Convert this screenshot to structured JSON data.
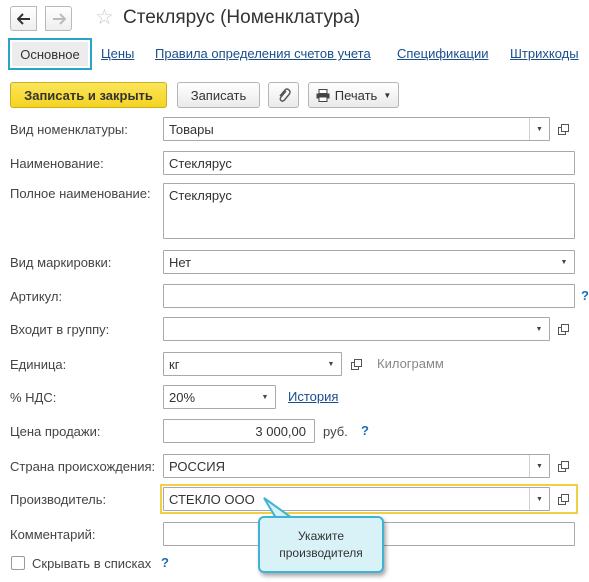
{
  "window": {
    "title": "Стеклярус (Номенклатура)",
    "star_icon": "star-icon"
  },
  "tabs": [
    {
      "label": "Основное",
      "active": true
    },
    {
      "label": "Цены"
    },
    {
      "label": "Правила определения счетов учета"
    },
    {
      "label": "Спецификации"
    },
    {
      "label": "Штрихкоды"
    }
  ],
  "toolbar": {
    "save_close": "Записать и закрыть",
    "save": "Записать",
    "print": "Печать"
  },
  "form": {
    "kind": {
      "label": "Вид номенклатуры:",
      "value": "Товары"
    },
    "name": {
      "label": "Наименование:",
      "value": "Стеклярус"
    },
    "full_name": {
      "label": "Полное наименование:",
      "value": "Стеклярус"
    },
    "marking": {
      "label": "Вид маркировки:",
      "value": "Нет"
    },
    "article": {
      "label": "Артикул:",
      "value": "",
      "hint": "?"
    },
    "group": {
      "label": "Входит в группу:",
      "value": ""
    },
    "unit": {
      "label": "Единица:",
      "value": "кг",
      "description": "Килограмм"
    },
    "vat": {
      "label": "% НДС:",
      "value": "20%",
      "history_link": "История"
    },
    "price": {
      "label": "Цена продажи:",
      "value": "3 000,00",
      "currency": "руб.",
      "hint": "?"
    },
    "country": {
      "label": "Страна происхождения:",
      "value": "РОССИЯ"
    },
    "manufacturer": {
      "label": "Производитель:",
      "value": "СТЕКЛО ООО"
    },
    "comment": {
      "label": "Комментарий:",
      "value": ""
    },
    "hide_in_lists": {
      "label": "Скрывать в списках",
      "checked": false,
      "hint": "?"
    }
  },
  "tooltip": {
    "line1": "Укажите",
    "line2": "производителя"
  },
  "colors": {
    "accent": "#2ba3c9",
    "primary_button": "#f4d421",
    "highlight": "#f0cf45",
    "link": "#1a4e8c"
  }
}
